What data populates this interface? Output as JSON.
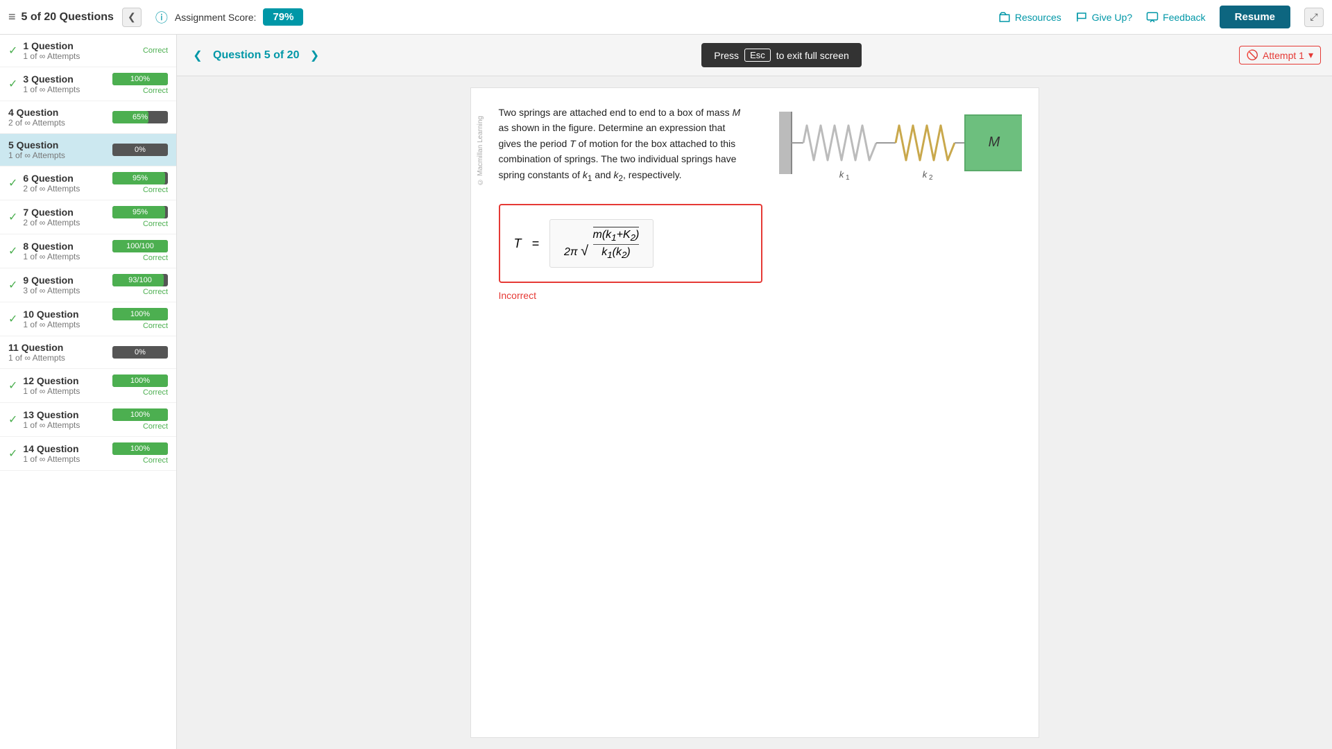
{
  "header": {
    "questions_count": "5 of 20 Questions",
    "assignment_score_label": "Assignment Score:",
    "score": "79%",
    "resources_label": "Resources",
    "giveup_label": "Give Up?",
    "feedback_label": "Feedback",
    "resume_label": "Resume",
    "collapse_icon": "❮",
    "expand_icon": "⤢"
  },
  "question_nav": {
    "title": "Question 5 of 20",
    "prev_icon": "❮",
    "next_icon": "❯",
    "esc_text": "Press",
    "esc_key": "Esc",
    "esc_suffix": "to exit full screen",
    "attempt_label": "Attempt 1",
    "attempt_dropdown_icon": "▾",
    "attempt_icon": "🚫"
  },
  "sidebar": {
    "scroll_up": "▲",
    "scroll_down": "▼",
    "items": [
      {
        "id": 1,
        "title": "1 Question",
        "subtitle": "1 of ∞ Attempts",
        "progress": null,
        "progress_label": null,
        "status": "Correct",
        "has_check": true,
        "active": false
      },
      {
        "id": 3,
        "title": "3 Question",
        "subtitle": "1 of ∞ Attempts",
        "progress": 100,
        "progress_label": "100%",
        "status": "Correct",
        "has_check": true,
        "active": false
      },
      {
        "id": 4,
        "title": "4 Question",
        "subtitle": "2 of ∞ Attempts",
        "progress": 65,
        "progress_label": "65%",
        "status": "",
        "has_check": false,
        "active": false
      },
      {
        "id": 5,
        "title": "5 Question",
        "subtitle": "1 of ∞ Attempts",
        "progress": 0,
        "progress_label": "0%",
        "status": "",
        "has_check": false,
        "active": true
      },
      {
        "id": 6,
        "title": "6 Question",
        "subtitle": "2 of ∞ Attempts",
        "progress": 95,
        "progress_label": "95%",
        "status": "Correct",
        "has_check": true,
        "active": false
      },
      {
        "id": 7,
        "title": "7 Question",
        "subtitle": "2 of ∞ Attempts",
        "progress": 95,
        "progress_label": "95%",
        "status": "Correct",
        "has_check": true,
        "active": false
      },
      {
        "id": 8,
        "title": "8 Question",
        "subtitle": "1 of ∞ Attempts",
        "progress": 100,
        "progress_label": "100/100",
        "status": "Correct",
        "has_check": true,
        "active": false
      },
      {
        "id": 9,
        "title": "9 Question",
        "subtitle": "3 of ∞ Attempts",
        "progress": 93,
        "progress_label": "93/100",
        "status": "Correct",
        "has_check": true,
        "active": false
      },
      {
        "id": 10,
        "title": "10 Question",
        "subtitle": "1 of ∞ Attempts",
        "progress": 100,
        "progress_label": "100%",
        "status": "Correct",
        "has_check": true,
        "active": false
      },
      {
        "id": 11,
        "title": "11 Question",
        "subtitle": "1 of ∞ Attempts",
        "progress": 0,
        "progress_label": "0%",
        "status": "",
        "has_check": false,
        "active": false
      },
      {
        "id": 12,
        "title": "12 Question",
        "subtitle": "1 of ∞ Attempts",
        "progress": 100,
        "progress_label": "100%",
        "status": "Correct",
        "has_check": true,
        "active": false
      },
      {
        "id": 13,
        "title": "13 Question",
        "subtitle": "1 of ∞ Attempts",
        "progress": 100,
        "progress_label": "100%",
        "status": "Correct",
        "has_check": true,
        "active": false
      },
      {
        "id": 14,
        "title": "14 Question",
        "subtitle": "1 of ∞ Attempts",
        "progress": 100,
        "progress_label": "100%",
        "status": "Correct",
        "has_check": true,
        "active": false
      }
    ]
  },
  "question": {
    "text": "Two springs are attached end to end to a box of mass M as shown in the figure. Determine an expression that gives the period T of motion for the box attached to this combination of springs. The two individual springs have spring constants of k₁ and k₂, respectively.",
    "answer_formula": "T = 2π√(m(k₁+k₂)/(k₁(k₂)))",
    "answer_status": "Incorrect",
    "watermark": "© Macmillan Learning"
  }
}
